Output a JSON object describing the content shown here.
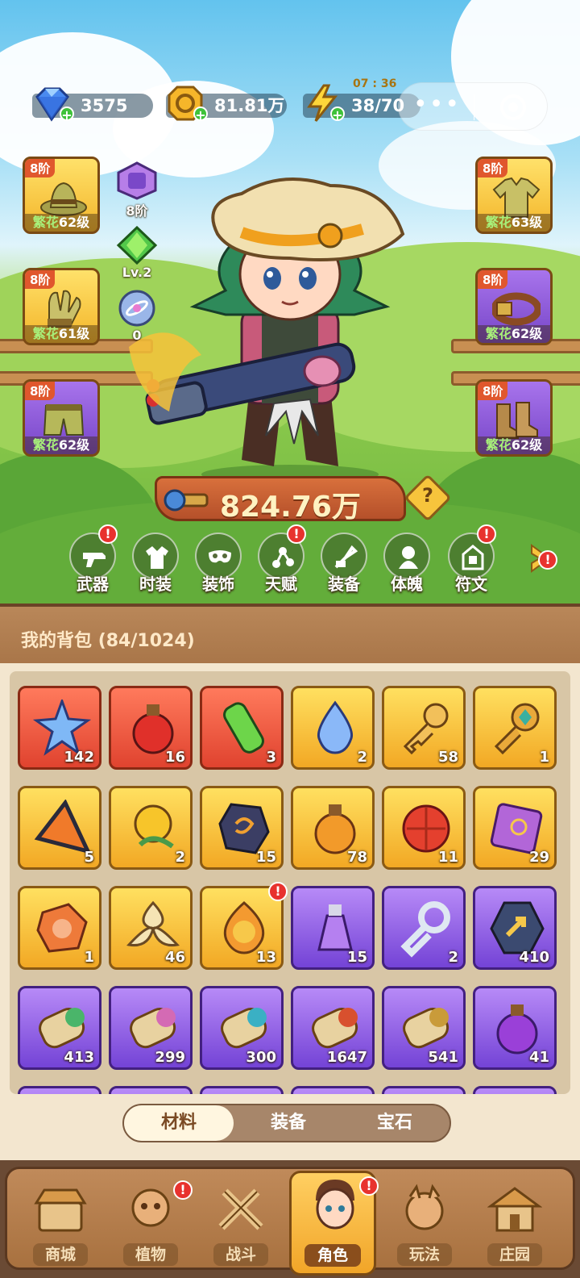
{
  "resources": [
    {
      "name": "diamond",
      "value": "3575"
    },
    {
      "name": "gold",
      "value": "81.81万"
    },
    {
      "name": "energy",
      "value": "38/70",
      "timer": "07 : 36"
    }
  ],
  "capsule": {
    "menu": "•••",
    "close": "◎"
  },
  "left_slots": [
    {
      "tier": "8阶",
      "tag": "繁花",
      "level": "62级",
      "rarity": "gold",
      "icon": "hat-icon"
    },
    {
      "tier": "8阶",
      "tag": "繁花",
      "level": "61级",
      "rarity": "gold",
      "icon": "gloves-icon"
    },
    {
      "tier": "8阶",
      "tag": "繁花",
      "level": "62级",
      "rarity": "purple",
      "icon": "pants-icon"
    }
  ],
  "right_slots": [
    {
      "tier": "8阶",
      "tag": "繁花",
      "level": "63级",
      "rarity": "gold",
      "icon": "shirt-icon"
    },
    {
      "tier": "8阶",
      "tag": "繁花",
      "level": "62级",
      "rarity": "purple",
      "icon": "belt-icon"
    },
    {
      "tier": "8阶",
      "tag": "繁花",
      "level": "62级",
      "rarity": "purple",
      "icon": "boots-icon"
    }
  ],
  "mini_slots": [
    {
      "label": "8阶",
      "icon": "backpack-icon"
    },
    {
      "label": "Lv.2",
      "icon": "green-gem-icon"
    },
    {
      "label": "0",
      "icon": "orb-icon"
    }
  ],
  "power": "824.76万",
  "functions": [
    {
      "label": "武器",
      "badge": true,
      "icon": "gun-icon"
    },
    {
      "label": "时装",
      "badge": false,
      "icon": "coat-icon"
    },
    {
      "label": "装饰",
      "badge": false,
      "icon": "mask-icon"
    },
    {
      "label": "天赋",
      "badge": true,
      "icon": "talent-icon"
    },
    {
      "label": "装备",
      "badge": false,
      "icon": "equip-icon"
    },
    {
      "label": "体魄",
      "badge": false,
      "icon": "body-icon"
    },
    {
      "label": "符文",
      "badge": true,
      "icon": "rune-icon"
    }
  ],
  "bag": {
    "title": "我的背包",
    "capacity": "(84/1024)",
    "items": [
      {
        "count": "142",
        "rarity": "red",
        "icon": "star-crystal-icon",
        "color": "#7fb8f6"
      },
      {
        "count": "16",
        "rarity": "red",
        "icon": "red-potion-icon",
        "color": "#e0302a"
      },
      {
        "count": "3",
        "rarity": "red",
        "icon": "green-tube-icon",
        "color": "#6dd54a"
      },
      {
        "count": "2",
        "rarity": "gold",
        "icon": "water-drop-icon",
        "color": "#8ab8f8"
      },
      {
        "count": "58",
        "rarity": "gold",
        "icon": "gold-key-icon",
        "color": "#f2c05a"
      },
      {
        "count": "1",
        "rarity": "gold",
        "icon": "gem-key-icon",
        "color": "#e9a93a"
      },
      {
        "count": "5",
        "rarity": "gold",
        "icon": "prism-icon",
        "color": "#f07a2a"
      },
      {
        "count": "2",
        "rarity": "gold",
        "icon": "golden-flower-icon",
        "color": "#f7c52a"
      },
      {
        "count": "15",
        "rarity": "gold",
        "icon": "rune-stone-icon",
        "color": "#3b3e64"
      },
      {
        "count": "78",
        "rarity": "gold",
        "icon": "orange-potion-icon",
        "color": "#f29a2a"
      },
      {
        "count": "11",
        "rarity": "gold",
        "icon": "red-flower-icon",
        "color": "#e4402e"
      },
      {
        "count": "29",
        "rarity": "gold",
        "icon": "spell-book-icon",
        "color": "#b266d8"
      },
      {
        "count": "1",
        "rarity": "gold",
        "icon": "orange-ore-icon",
        "color": "#ee7a3a"
      },
      {
        "count": "46",
        "rarity": "gold",
        "icon": "knot-icon",
        "color": "#f5e4b4"
      },
      {
        "count": "13",
        "rarity": "gold",
        "icon": "mystery-flame-icon",
        "color": "#f39a30",
        "badge": true
      },
      {
        "count": "15",
        "rarity": "purple",
        "icon": "purple-vial-icon",
        "color": "#b580f0"
      },
      {
        "count": "2",
        "rarity": "purple",
        "icon": "silver-key-icon",
        "color": "#dfe8f2"
      },
      {
        "count": "410",
        "rarity": "purple",
        "icon": "arrow-coin-icon",
        "color": "#3b4a70"
      },
      {
        "count": "413",
        "rarity": "purple",
        "icon": "scroll-green-icon",
        "color": "#4ab56a"
      },
      {
        "count": "299",
        "rarity": "purple",
        "icon": "scroll-pink-icon",
        "color": "#d46ab4"
      },
      {
        "count": "300",
        "rarity": "purple",
        "icon": "scroll-teal-icon",
        "color": "#3ab0c4"
      },
      {
        "count": "1647",
        "rarity": "purple",
        "icon": "scroll-red-icon",
        "color": "#d8502e"
      },
      {
        "count": "541",
        "rarity": "purple",
        "icon": "scroll-bolt-icon",
        "color": "#c99b3a"
      },
      {
        "count": "41",
        "rarity": "purple",
        "icon": "purple-potion-icon",
        "color": "#9a40d8"
      }
    ]
  },
  "tabs": [
    {
      "label": "材料",
      "active": true
    },
    {
      "label": "装备",
      "active": false
    },
    {
      "label": "宝石",
      "active": false
    }
  ],
  "nav": [
    {
      "label": "商城",
      "badge": false,
      "active": false,
      "icon": "shop-icon"
    },
    {
      "label": "植物",
      "badge": true,
      "active": false,
      "icon": "plant-icon"
    },
    {
      "label": "战斗",
      "badge": false,
      "active": false,
      "icon": "battle-icon"
    },
    {
      "label": "角色",
      "badge": true,
      "active": true,
      "icon": "character-icon"
    },
    {
      "label": "玩法",
      "badge": false,
      "active": false,
      "icon": "gameplay-icon"
    },
    {
      "label": "庄园",
      "badge": false,
      "active": false,
      "icon": "manor-icon"
    }
  ],
  "colors": {
    "accent": "#f2a824",
    "badge": "#e8322e",
    "panel": "#f3e6cf"
  }
}
